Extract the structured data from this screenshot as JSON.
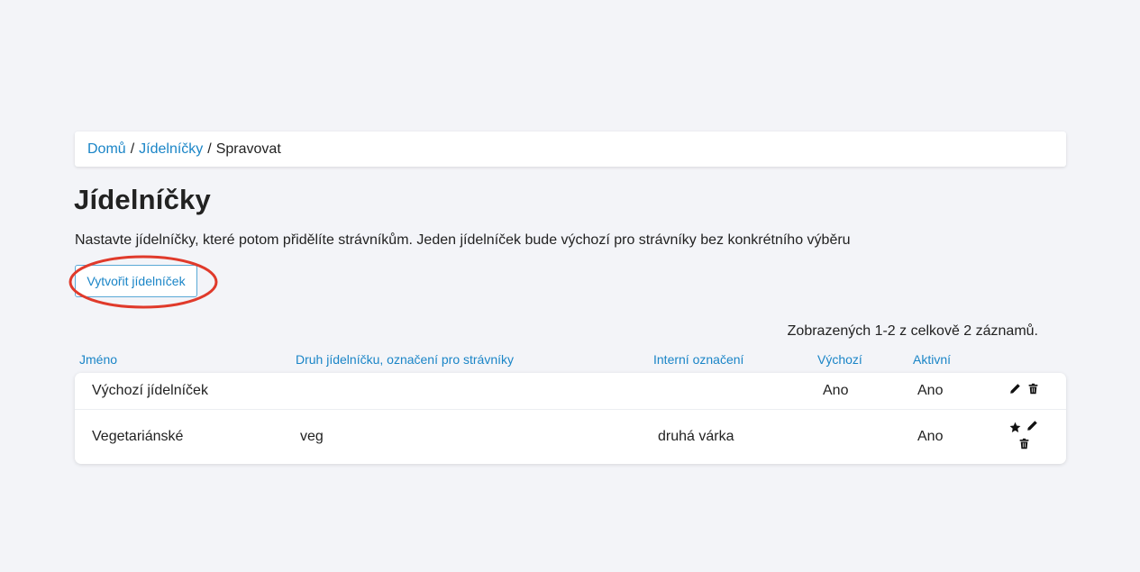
{
  "breadcrumb": {
    "home": "Domů",
    "section": "Jídelníčky",
    "current": "Spravovat",
    "separator": "/"
  },
  "page": {
    "title": "Jídelníčky",
    "description": "Nastavte jídelníčky, které potom přidělíte strávníkům. Jeden jídelníček bude výchozí pro strávníky bez konkrétního výběru",
    "create_button": "Vytvořit jídelníček"
  },
  "records_info": "Zobrazených 1-2 z celkově 2 záznamů.",
  "table": {
    "columns": {
      "name": "Jméno",
      "type": "Druh jídelníčku, označení pro strávníky",
      "internal": "Interní označení",
      "default": "Výchozí",
      "active": "Aktivní"
    },
    "rows": [
      {
        "name": "Výchozí jídelníček",
        "type": "",
        "internal": "",
        "default": "Ano",
        "active": "Ano",
        "actions": [
          "edit-icon",
          "trash-icon"
        ]
      },
      {
        "name": "Vegetariánské",
        "type": "veg",
        "internal": "druhá várka",
        "default": "",
        "active": "Ano",
        "actions": [
          "star-icon",
          "edit-icon",
          "trash-icon"
        ]
      }
    ]
  },
  "colors": {
    "link": "#1a85c7",
    "background": "#f3f4f8",
    "highlight": "#e03a2b"
  }
}
